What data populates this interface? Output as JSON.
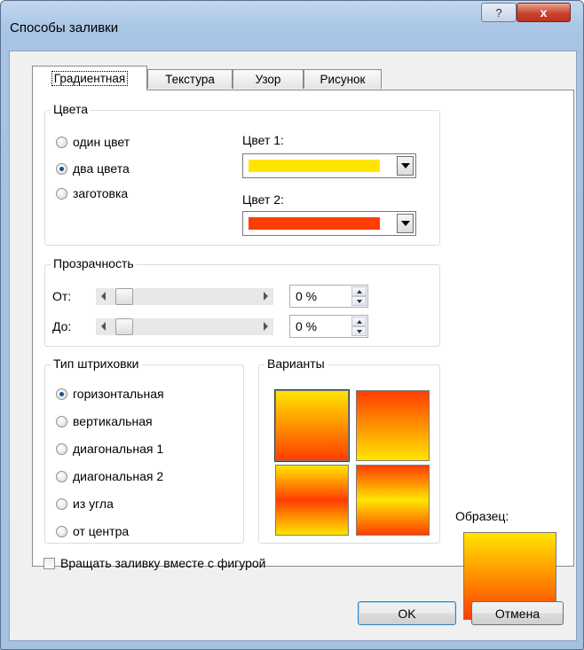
{
  "window": {
    "title": "Способы заливки",
    "help_icon_glyph": "?",
    "close_icon_glyph": "x"
  },
  "tabs": [
    {
      "label": "Градиентная",
      "active": true
    },
    {
      "label": "Текстура",
      "active": false
    },
    {
      "label": "Узор",
      "active": false
    },
    {
      "label": "Рисунок",
      "active": false
    }
  ],
  "colors_group": {
    "legend": "Цвета",
    "options": [
      {
        "label": "один цвет",
        "checked": false
      },
      {
        "label": "два цвета",
        "checked": true
      },
      {
        "label": "заготовка",
        "checked": false
      }
    ],
    "color1_label": "Цвет 1:",
    "color1_value": "#ffe500",
    "color2_label": "Цвет 2:",
    "color2_value": "#ff3d00"
  },
  "transparency_group": {
    "legend": "Прозрачность",
    "from_label": "От:",
    "from_value": "0 %",
    "to_label": "До:",
    "to_value": "0 %"
  },
  "hatch_group": {
    "legend": "Тип штриховки",
    "options": [
      {
        "label": "горизонтальная",
        "checked": true
      },
      {
        "label": "вертикальная",
        "checked": false
      },
      {
        "label": "диагональная 1",
        "checked": false
      },
      {
        "label": "диагональная 2",
        "checked": false
      },
      {
        "label": "из угла",
        "checked": false
      },
      {
        "label": "от центра",
        "checked": false
      }
    ]
  },
  "variants_group": {
    "legend": "Варианты"
  },
  "sample": {
    "label": "Образец:"
  },
  "rotate_checkbox": {
    "label": "Вращать заливку вместе с фигурой",
    "checked": false
  },
  "buttons": {
    "ok": "OK",
    "cancel": "Отмена"
  }
}
